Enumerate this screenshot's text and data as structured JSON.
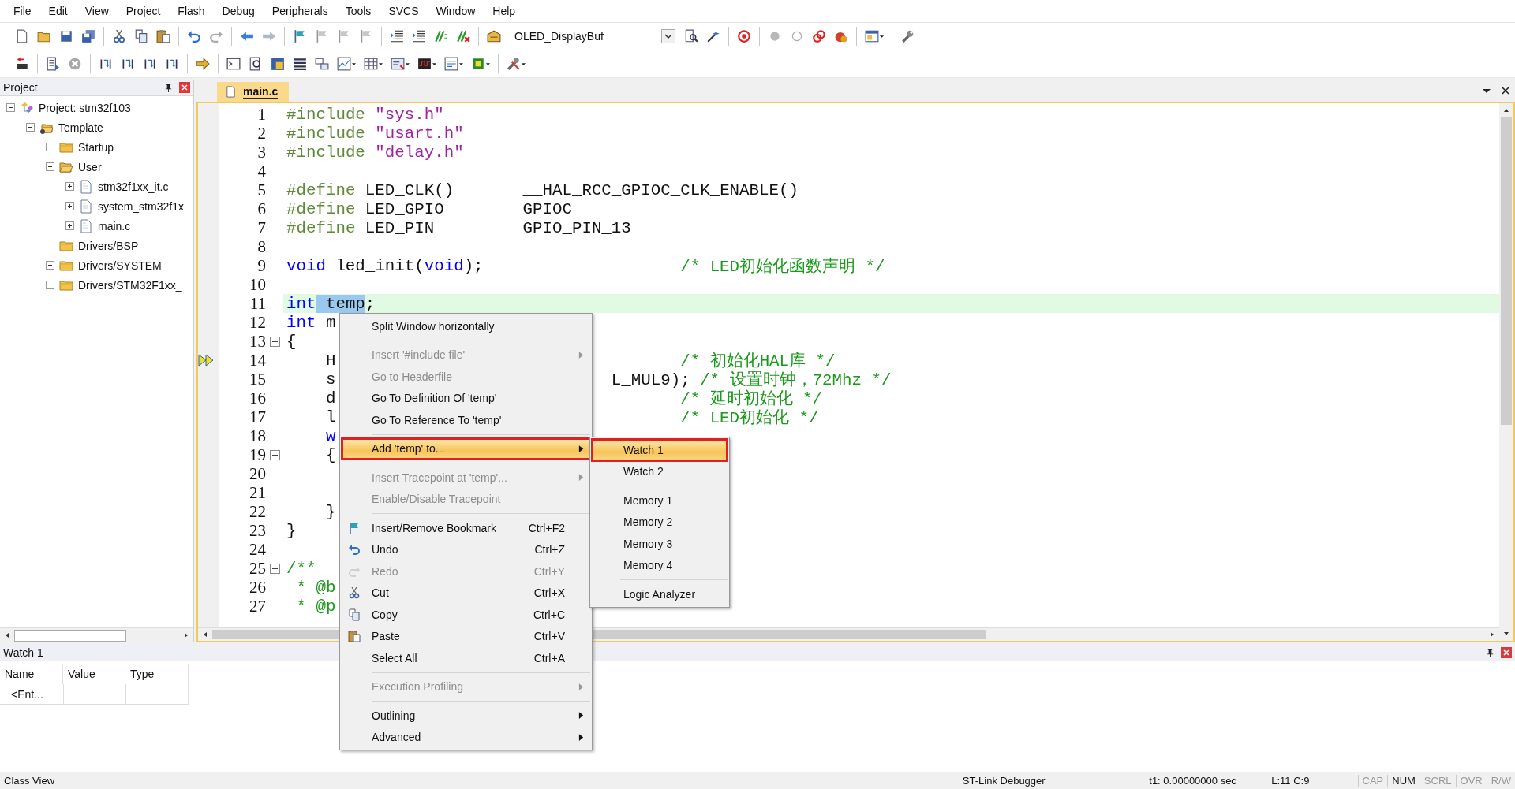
{
  "menu_bar": [
    "File",
    "Edit",
    "View",
    "Project",
    "Flash",
    "Debug",
    "Peripherals",
    "Tools",
    "SVCS",
    "Window",
    "Help"
  ],
  "toolbar": {
    "target": "OLED_DisplayBuf"
  },
  "project_panel": {
    "title": "Project",
    "tree": [
      {
        "label": "Project: stm32f103",
        "kind": "project",
        "expanded": true,
        "children": [
          {
            "label": "Template",
            "kind": "target",
            "expanded": true,
            "children": [
              {
                "label": "Startup",
                "kind": "group",
                "expanded": false
              },
              {
                "label": "User",
                "kind": "group",
                "expanded": true,
                "children": [
                  {
                    "label": "stm32f1xx_it.c",
                    "kind": "file",
                    "expanded": false
                  },
                  {
                    "label": "system_stm32f1x",
                    "kind": "file",
                    "expanded": false
                  },
                  {
                    "label": "main.c",
                    "kind": "file",
                    "expanded": false
                  }
                ]
              },
              {
                "label": "Drivers/BSP",
                "kind": "group"
              },
              {
                "label": "Drivers/SYSTEM",
                "kind": "group",
                "expanded": false
              },
              {
                "label": "Drivers/STM32F1xx_",
                "kind": "group",
                "expanded": false
              }
            ]
          }
        ]
      }
    ]
  },
  "editor": {
    "tabs": [
      {
        "label": "main.c",
        "selected": true
      }
    ],
    "lines": [
      {
        "n": "1",
        "current": false,
        "exec": false,
        "code": [
          {
            "kind": "directive",
            "text": "#include"
          },
          {
            "kind": "string",
            "text": "\"sys.h\""
          }
        ]
      },
      {
        "n": "2",
        "current": false,
        "exec": false,
        "code": [
          {
            "kind": "directive",
            "text": "#include"
          },
          {
            "kind": "string",
            "text": "\"usart.h\""
          }
        ]
      },
      {
        "n": "3",
        "current": false,
        "exec": false,
        "code": [
          {
            "kind": "directive",
            "text": "#include"
          },
          {
            "kind": "string",
            "text": "\"delay.h\""
          }
        ]
      },
      {
        "n": "4",
        "current": false,
        "exec": false
      },
      {
        "n": "5",
        "current": false,
        "exec": false,
        "code": [
          {
            "kind": "directive",
            "text": "#define"
          },
          {
            "kind": "plain",
            "text": "LED_CLK()       __HAL_RCC_GPIOC_CLK_ENABLE()"
          }
        ]
      },
      {
        "n": "6",
        "current": false,
        "exec": false,
        "code": [
          {
            "kind": "directive",
            "text": "#define"
          },
          {
            "kind": "plain",
            "text": "LED_GPIO        GPIOC"
          }
        ]
      },
      {
        "n": "7",
        "current": false,
        "exec": false,
        "code": [
          {
            "kind": "directive",
            "text": "#define"
          },
          {
            "kind": "plain",
            "text": "LED_PIN         GPIO_PIN_13"
          }
        ]
      },
      {
        "n": "8",
        "current": false,
        "exec": false
      },
      {
        "n": "9",
        "current": false,
        "exec": false,
        "code": [
          {
            "kind": "keyword",
            "text": "void"
          },
          {
            "kind": "plain",
            "text": "led_init("
          },
          {
            "kind": "keyword",
            "text": "void",
            "join": true
          },
          {
            "kind": "plain",
            "text": ");",
            "join": true
          }
        ],
        "tail": [
          {
            "kind": "comment",
            "text": "/* LED初始化函数声明 */"
          }
        ]
      },
      {
        "n": "10",
        "current": false,
        "exec": false
      },
      {
        "n": "11",
        "current": true,
        "exec": false,
        "code": [
          {
            "kind": "keyword",
            "text": "int"
          },
          {
            "kind": "selected",
            "text": "temp"
          },
          {
            "kind": "plain",
            "text": ";",
            "join": true
          }
        ]
      },
      {
        "n": "12",
        "current": false,
        "exec": false,
        "code": [
          {
            "kind": "keyword",
            "text": "int"
          },
          {
            "kind": "plain",
            "text": "m"
          }
        ]
      },
      {
        "n": "13",
        "current": false,
        "exec": false,
        "fold": true,
        "code": [
          {
            "kind": "plain",
            "text": "{"
          }
        ]
      },
      {
        "n": "14",
        "current": false,
        "exec": true,
        "code": [
          {
            "kind": "plain",
            "text": "H",
            "indent": true
          }
        ],
        "tail": [
          {
            "kind": "comment",
            "text": "/* 初始化HAL库 */"
          }
        ]
      },
      {
        "n": "15",
        "current": false,
        "exec": false,
        "code": [
          {
            "kind": "plain",
            "text": "s",
            "indent": true
          }
        ],
        "tail": [
          {
            "kind": "plain",
            "text": "L_MUL9);"
          },
          {
            "kind": "comment",
            "text": "/* 设置时钟，72Mhz */"
          }
        ]
      },
      {
        "n": "16",
        "current": false,
        "exec": false,
        "code": [
          {
            "kind": "plain",
            "text": "d",
            "indent": true
          }
        ],
        "tail": [
          {
            "kind": "comment",
            "text": "/* 延时初始化 */"
          }
        ]
      },
      {
        "n": "17",
        "current": false,
        "exec": false,
        "code": [
          {
            "kind": "plain",
            "text": "l",
            "indent": true
          }
        ],
        "tail": [
          {
            "kind": "comment",
            "text": "/* LED初始化 */"
          }
        ]
      },
      {
        "n": "18",
        "current": false,
        "exec": false,
        "code": [
          {
            "kind": "keyword",
            "text": "w",
            "indent": true
          }
        ]
      },
      {
        "n": "19",
        "current": false,
        "exec": false,
        "fold": true,
        "code": [
          {
            "kind": "plain",
            "text": "{",
            "indent": true
          }
        ]
      },
      {
        "n": "20",
        "current": false,
        "exec": false
      },
      {
        "n": "21",
        "current": false,
        "exec": false
      },
      {
        "n": "22",
        "current": false,
        "exec": false,
        "code": [
          {
            "kind": "plain",
            "text": "}",
            "indent": true
          }
        ]
      },
      {
        "n": "23",
        "current": false,
        "exec": false,
        "code": [
          {
            "kind": "plain",
            "text": "}"
          }
        ]
      },
      {
        "n": "24",
        "current": false,
        "exec": false
      },
      {
        "n": "25",
        "current": false,
        "exec": false,
        "fold": true,
        "code": [
          {
            "kind": "comment",
            "text": "/**"
          }
        ]
      },
      {
        "n": "26",
        "current": false,
        "exec": false,
        "code": [
          {
            "kind": "comment",
            "text": "* @b",
            "step": true
          }
        ]
      },
      {
        "n": "27",
        "current": false,
        "exec": false,
        "code": [
          {
            "kind": "comment",
            "text": "* @p",
            "step": true
          }
        ]
      }
    ]
  },
  "context_menu": {
    "items": [
      {
        "kind": "item",
        "label": "Split Window horizontally",
        "disabled": false,
        "selected": false,
        "submenu": false,
        "marked": false
      },
      {
        "kind": "separator"
      },
      {
        "kind": "item",
        "label": "Insert '#include file'",
        "disabled": true,
        "selected": false,
        "submenu": true,
        "marked": false
      },
      {
        "kind": "item",
        "label": "Go to Headerfile",
        "disabled": true,
        "selected": false,
        "submenu": false,
        "marked": false
      },
      {
        "kind": "item",
        "label": "Go To Definition Of 'temp'",
        "disabled": false,
        "selected": false,
        "submenu": false,
        "marked": false
      },
      {
        "kind": "item",
        "label": "Go To Reference To 'temp'",
        "disabled": false,
        "selected": false,
        "submenu": false,
        "marked": false
      },
      {
        "kind": "separator"
      },
      {
        "kind": "item",
        "label": "Add 'temp' to...",
        "disabled": false,
        "selected": true,
        "submenu": true,
        "marked": true
      },
      {
        "kind": "separator"
      },
      {
        "kind": "item",
        "label": "Insert Tracepoint at 'temp'...",
        "disabled": true,
        "selected": false,
        "submenu": true,
        "marked": false
      },
      {
        "kind": "item",
        "label": "Enable/Disable Tracepoint",
        "disabled": true,
        "selected": false,
        "submenu": false,
        "marked": false
      },
      {
        "kind": "separator"
      },
      {
        "kind": "item",
        "label": "Insert/Remove Bookmark",
        "shortcut": "Ctrl+F2",
        "disabled": false,
        "selected": false,
        "submenu": false,
        "marked": false
      },
      {
        "kind": "item",
        "label": "Undo",
        "shortcut": "Ctrl+Z",
        "disabled": false,
        "selected": false,
        "submenu": false,
        "marked": false
      },
      {
        "kind": "item",
        "label": "Redo",
        "shortcut": "Ctrl+Y",
        "disabled": true,
        "selected": false,
        "submenu": false,
        "marked": false
      },
      {
        "kind": "item",
        "label": "Cut",
        "shortcut": "Ctrl+X",
        "disabled": false,
        "selected": false,
        "submenu": false,
        "marked": false
      },
      {
        "kind": "item",
        "label": "Copy",
        "shortcut": "Ctrl+C",
        "disabled": false,
        "selected": false,
        "submenu": false,
        "marked": false
      },
      {
        "kind": "item",
        "label": "Paste",
        "shortcut": "Ctrl+V",
        "disabled": false,
        "selected": false,
        "submenu": false,
        "marked": false
      },
      {
        "kind": "item",
        "label": "Select All",
        "shortcut": "Ctrl+A",
        "disabled": false,
        "selected": false,
        "submenu": false,
        "marked": false
      },
      {
        "kind": "separator"
      },
      {
        "kind": "item",
        "label": "Execution Profiling",
        "disabled": true,
        "selected": false,
        "submenu": true,
        "marked": false
      },
      {
        "kind": "separator"
      },
      {
        "kind": "item",
        "label": "Outlining",
        "disabled": false,
        "selected": false,
        "submenu": true,
        "marked": false
      },
      {
        "kind": "item",
        "label": "Advanced",
        "disabled": false,
        "selected": false,
        "submenu": true,
        "marked": false
      }
    ]
  },
  "submenu": {
    "items": [
      {
        "kind": "item",
        "label": "Watch 1",
        "selected": true,
        "marked": true
      },
      {
        "kind": "item",
        "label": "Watch 2",
        "selected": false,
        "marked": false
      },
      {
        "kind": "separator"
      },
      {
        "kind": "item",
        "label": "Memory 1",
        "selected": false,
        "marked": false
      },
      {
        "kind": "item",
        "label": "Memory 2",
        "selected": false,
        "marked": false
      },
      {
        "kind": "item",
        "label": "Memory 3",
        "selected": false,
        "marked": false
      },
      {
        "kind": "item",
        "label": "Memory 4",
        "selected": false,
        "marked": false
      },
      {
        "kind": "separator"
      },
      {
        "kind": "item",
        "label": "Logic Analyzer",
        "selected": false,
        "marked": false
      }
    ]
  },
  "watch_panel": {
    "title": "Watch 1",
    "columns": [
      "Name",
      "Value",
      "Type"
    ],
    "rows": [
      {
        "name": "<Ent..."
      }
    ]
  },
  "status_bar": {
    "left": "Class View",
    "debugger": "ST-Link Debugger",
    "time": "t1: 0.00000000 sec",
    "position": "L:11 C:9",
    "indicators": [
      {
        "label": "CAP",
        "on": false
      },
      {
        "label": "NUM",
        "on": true
      },
      {
        "label": "SCRL",
        "on": false
      },
      {
        "label": "OVR",
        "on": false
      },
      {
        "label": "R/W",
        "on": false
      }
    ]
  }
}
